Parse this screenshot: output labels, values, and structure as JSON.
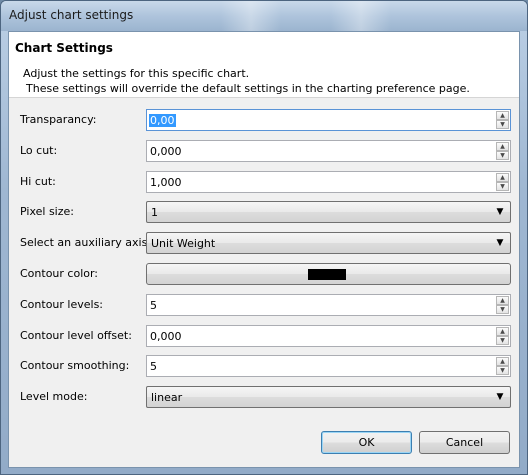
{
  "window": {
    "title": "Adjust chart settings"
  },
  "header": {
    "title": "Chart Settings",
    "description_line1": "Adjust the settings for this specific chart.",
    "description_line2": "These settings will override the default settings in the charting preference page."
  },
  "fields": {
    "transparency": {
      "label": "Transparancy:",
      "value": "0,00"
    },
    "lo_cut": {
      "label": "Lo cut:",
      "value": "0,000"
    },
    "hi_cut": {
      "label": "Hi cut:",
      "value": "1,000"
    },
    "pixel_size": {
      "label": "Pixel size:",
      "value": "1"
    },
    "aux_axis": {
      "label": "Select an auxiliary axis:",
      "value": "Unit Weight"
    },
    "contour_color": {
      "label": "Contour color:",
      "color": "#000000"
    },
    "contour_levels": {
      "label": "Contour levels:",
      "value": "5"
    },
    "contour_level_offset": {
      "label": "Contour level offset:",
      "value": "0,000"
    },
    "contour_smoothing": {
      "label": "Contour smoothing:",
      "value": "5"
    },
    "level_mode": {
      "label": "Level mode:",
      "value": "linear"
    }
  },
  "buttons": {
    "ok": "OK",
    "cancel": "Cancel"
  },
  "icons": {
    "spin_up": "▲",
    "spin_down": "▼",
    "combo_arrow": "▼"
  },
  "colors": {
    "selection": "#3399ff",
    "focus_border": "#5a93d6"
  }
}
